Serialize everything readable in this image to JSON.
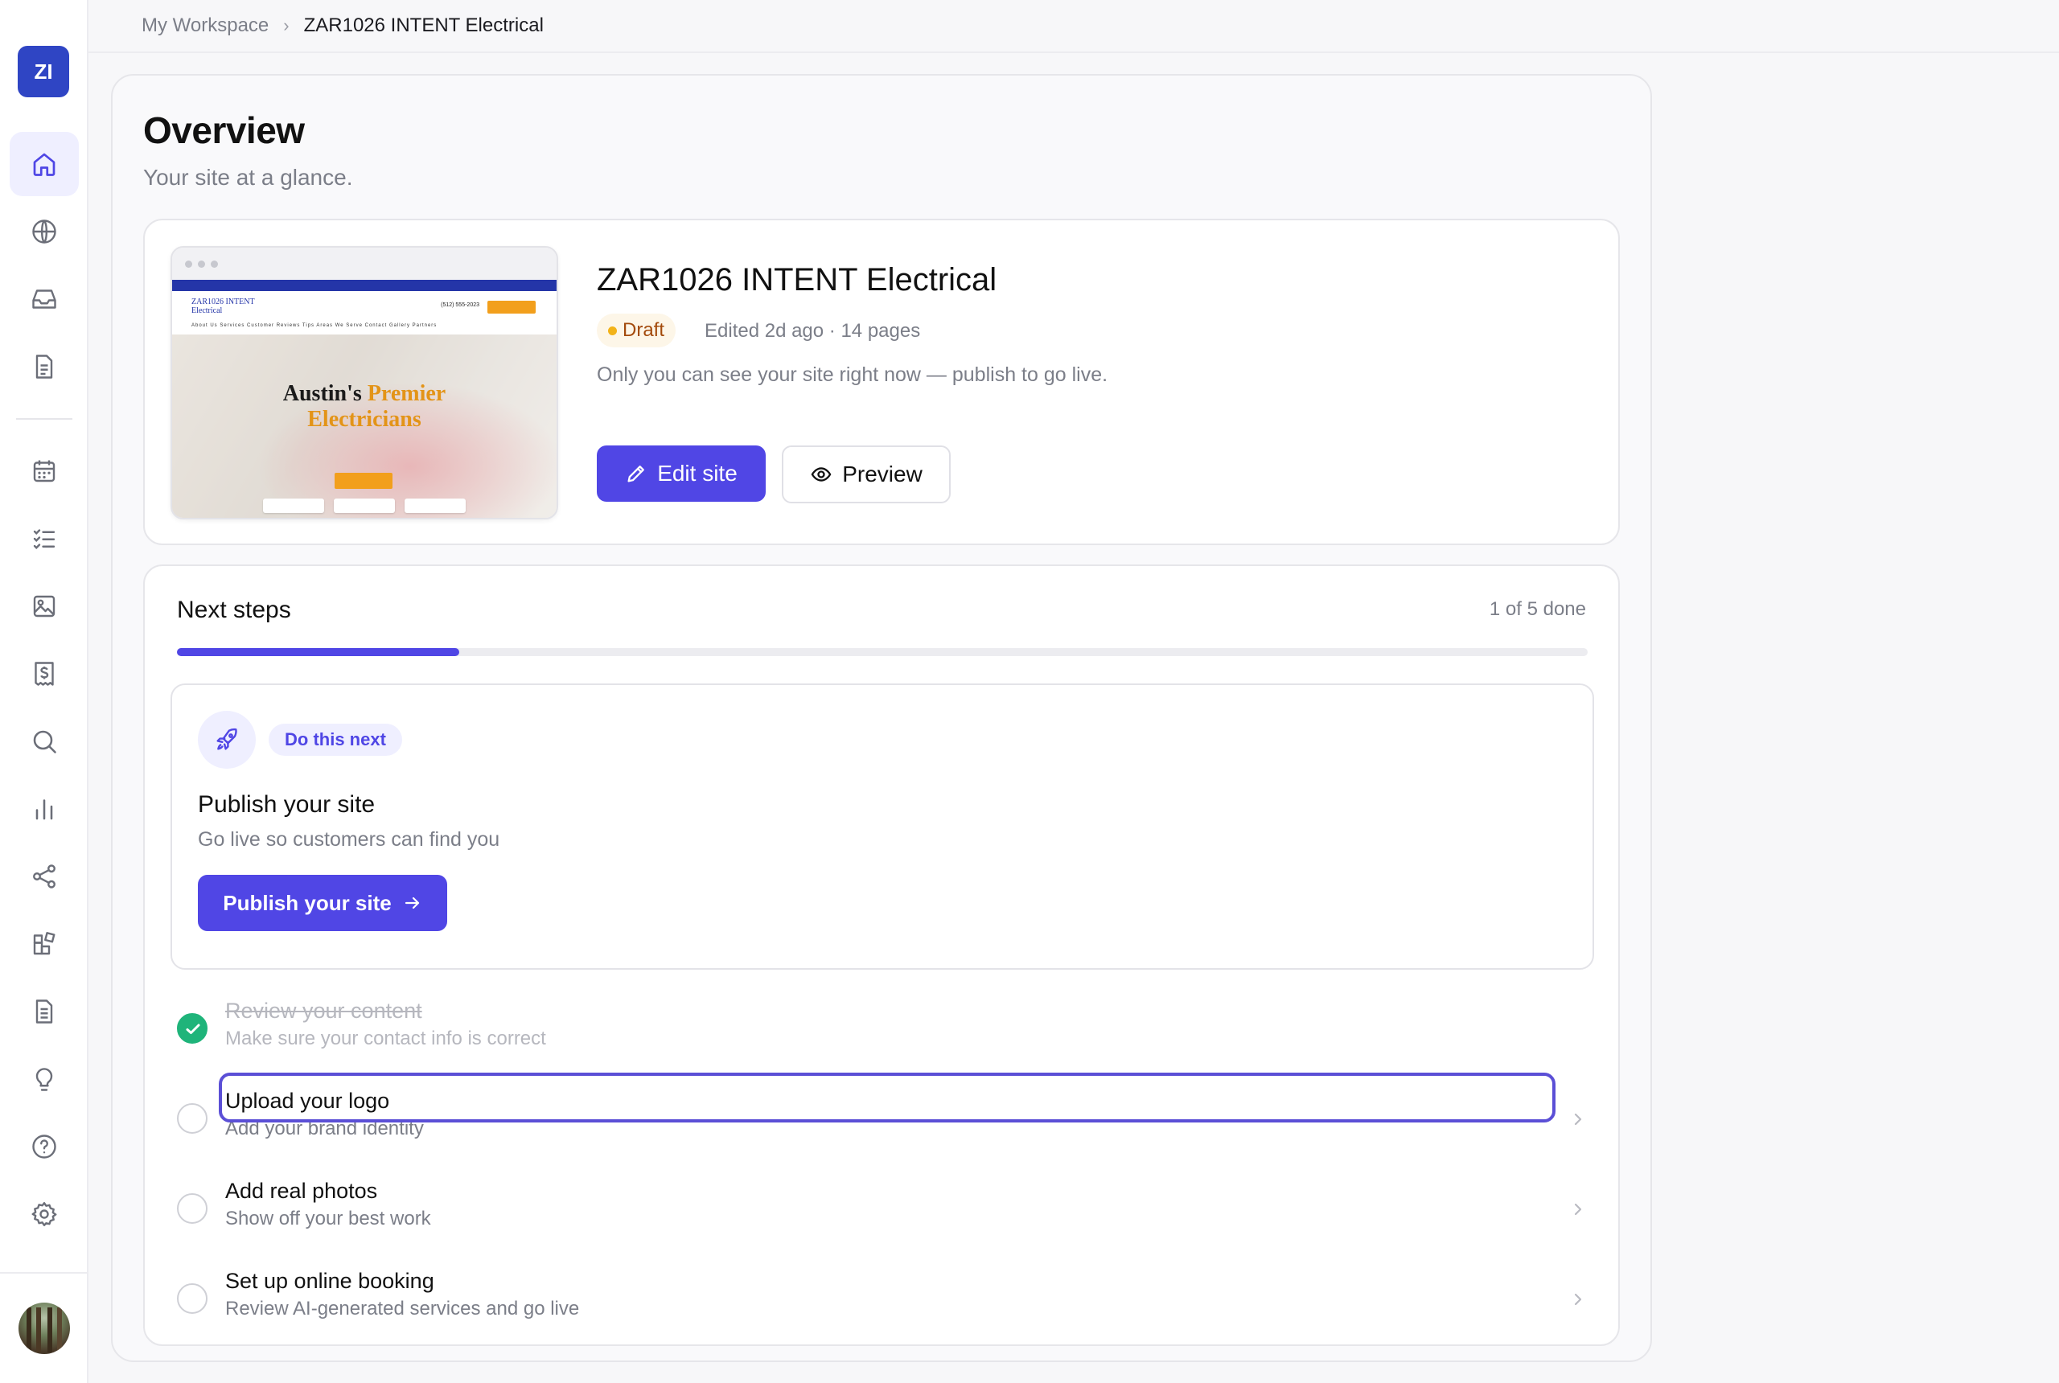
{
  "workspace": {
    "initials": "ZI"
  },
  "breadcrumb": {
    "root": "My Workspace",
    "separator": "›",
    "current": "ZAR1026 INTENT Electrical"
  },
  "page": {
    "title": "Overview",
    "subtitle": "Your site at a glance."
  },
  "site": {
    "name": "ZAR1026 INTENT Electrical",
    "status": "Draft",
    "meta": "Edited 2d ago · 14 pages",
    "note": "Only you can see your site right now — publish to go live.",
    "edit_label": "Edit site",
    "preview_label": "Preview",
    "thumbnail": {
      "logo_line1": "ZAR1026 INTENT",
      "logo_line2": "Electrical",
      "phone": "(512) 555-2023",
      "menu": "About Us  Services  Customer Reviews  Tips  Areas We Serve  Contact  Gallery  Partners",
      "headline_a": "Austin's ",
      "headline_b": "Premier",
      "headline_c": "Electricians"
    }
  },
  "steps": {
    "title": "Next steps",
    "count": "1 of 5 done",
    "progress": 0.2,
    "next": {
      "chip": "Do this next",
      "title": "Publish your site",
      "description": "Go live so customers can find you",
      "button": "Publish your site"
    },
    "items": [
      {
        "title": "Review your content",
        "description": "Make sure your contact info is correct",
        "done": true
      },
      {
        "title": "Upload your logo",
        "description": "Add your brand identity",
        "done": false
      },
      {
        "title": "Add real photos",
        "description": "Show off your best work",
        "done": false
      },
      {
        "title": "Set up online booking",
        "description": "Review AI-generated services and go live",
        "done": false
      }
    ]
  },
  "colors": {
    "accent": "#5046e5",
    "draft_bg": "#fdf6e8",
    "done": "#1fb47a"
  },
  "sidebar_icons": [
    "home-icon",
    "globe-icon",
    "inbox-icon",
    "document-icon",
    "calendar-icon",
    "checklist-icon",
    "image-icon",
    "invoice-icon",
    "search-icon",
    "bar-chart-icon",
    "share-icon",
    "apps-icon",
    "notes-icon",
    "lightbulb-icon",
    "help-icon",
    "gear-icon"
  ]
}
